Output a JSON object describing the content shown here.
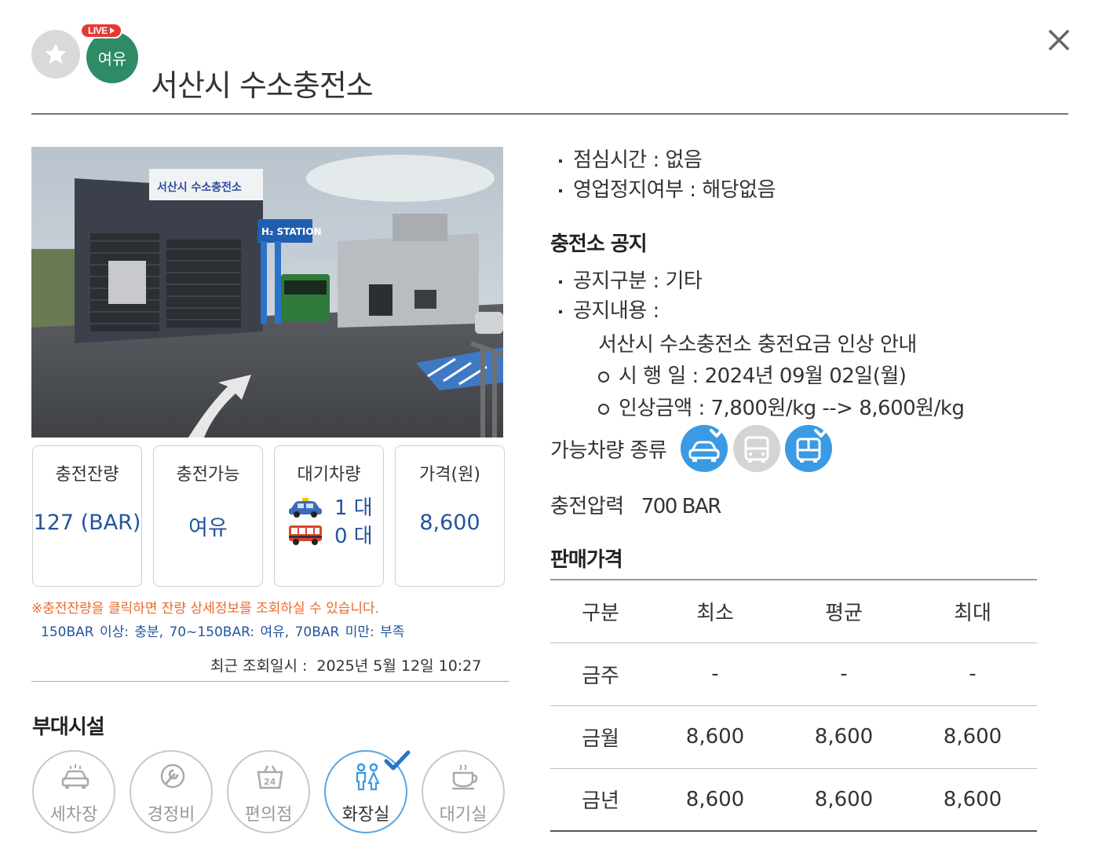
{
  "header": {
    "live_badge": "LIVE",
    "status_label": "여유",
    "title": "서산시 수소충전소"
  },
  "photo": {
    "sign_main": "서산시 수소충전소",
    "sign_h2": "H₂ STATION"
  },
  "stats": {
    "remaining": {
      "label": "충전잔량",
      "value": "127 (BAR)"
    },
    "availability": {
      "label": "충전가능",
      "value": "여유"
    },
    "waiting": {
      "label": "대기차량",
      "car": "1 대",
      "bus": "0 대"
    },
    "price": {
      "label": "가격(원)",
      "value": "8,600"
    }
  },
  "notes": {
    "red": "※충전잔량을 클릭하면 잔량 상세정보를 조회하실 수 있습니다.",
    "legend": "150BAR 이상: 충분,  70~150BAR: 여유,   70BAR 미만: 부족",
    "recent_label": "최근 조회일시 :",
    "recent_value": "2025년 5월 12일 10:27"
  },
  "facilities": {
    "title": "부대시설",
    "items": [
      {
        "label": "세차장",
        "icon": "car-wash-icon",
        "active": false
      },
      {
        "label": "경정비",
        "icon": "wrench-icon",
        "active": false
      },
      {
        "label": "편의점",
        "icon": "store-24-icon",
        "active": false
      },
      {
        "label": "화장실",
        "icon": "restroom-icon",
        "active": true
      },
      {
        "label": "대기실",
        "icon": "coffee-cup-icon",
        "active": false
      }
    ]
  },
  "info": {
    "lunch": "점심시간 : 없음",
    "suspension": "영업정지여부 : 해당없음"
  },
  "notice": {
    "title": "충전소 공지",
    "category": "공지구분 : 기타",
    "content_label": "공지내용 :",
    "line1": "서산시 수소충전소 충전요금 인상 안내",
    "line2": "시 행 일 : 2024년 09월 02일(월)",
    "line3": "인상금액 : 7,800원/kg --> 8,600원/kg"
  },
  "vehicles": {
    "label": "가능차량 종류",
    "types": [
      {
        "icon": "car-icon",
        "available": true
      },
      {
        "icon": "bus-icon",
        "available": false
      },
      {
        "icon": "city-bus-icon",
        "available": true
      }
    ]
  },
  "pressure": {
    "label": "충전압력",
    "value": "700 BAR"
  },
  "price_table": {
    "title": "판매가격",
    "headers": [
      "구분",
      "최소",
      "평균",
      "최대"
    ],
    "rows": [
      [
        "금주",
        "-",
        "-",
        "-"
      ],
      [
        "금월",
        "8,600",
        "8,600",
        "8,600"
      ],
      [
        "금년",
        "8,600",
        "8,600",
        "8,600"
      ]
    ]
  },
  "colors": {
    "status_green": "#2e8b66",
    "value_blue": "#24549c",
    "note_orange": "#e9692c",
    "vehicle_blue": "#3a9ae3",
    "live_red": "#e53935"
  }
}
